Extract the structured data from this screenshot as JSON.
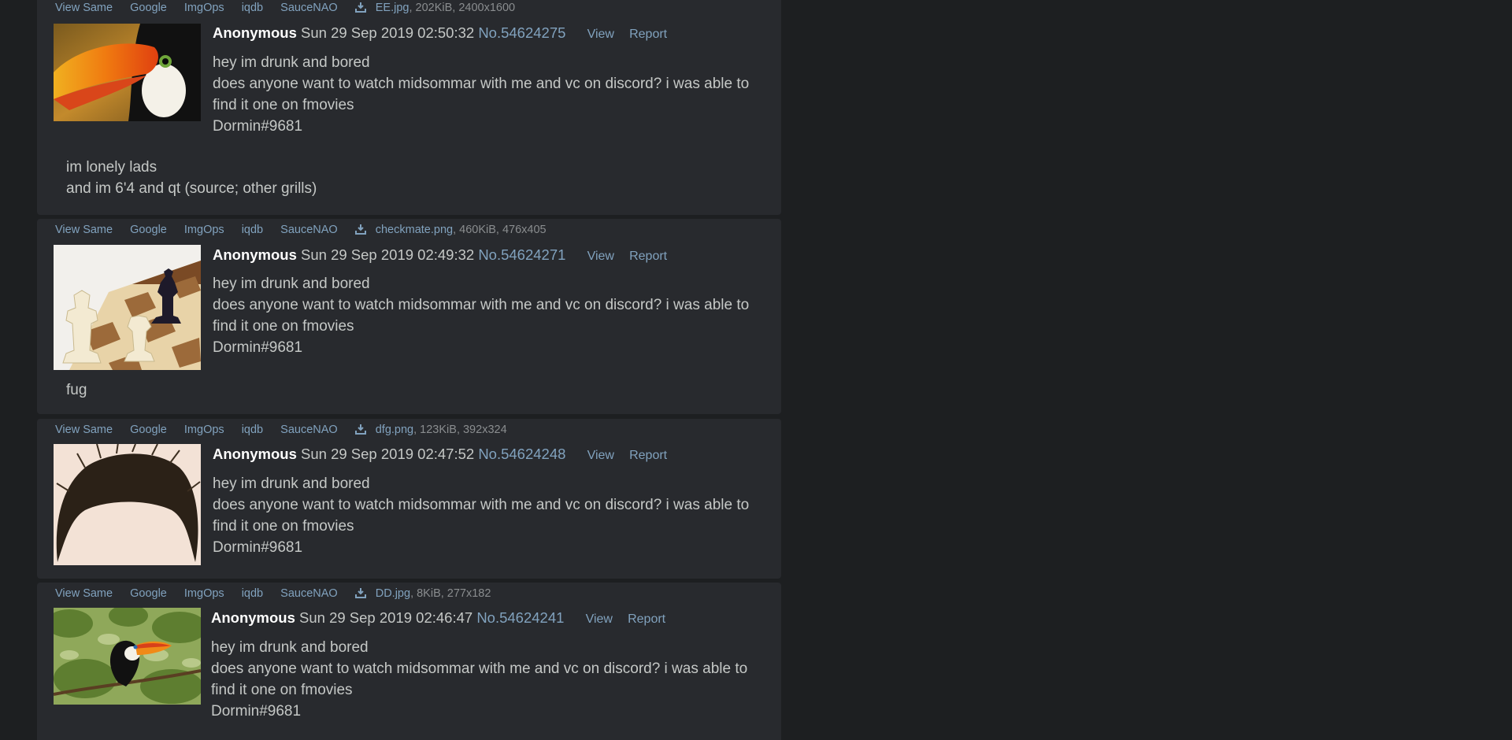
{
  "toolbar_labels": {
    "view_same": "View Same",
    "google": "Google",
    "imgops": "ImgOps",
    "iqdb": "iqdb",
    "saucenao": "SauceNAO",
    "download_icon": "download-icon"
  },
  "post_actions": {
    "view": "View",
    "report": "Report"
  },
  "posts": [
    {
      "file_name": "EE.jpg",
      "file_meta": ", 202KiB, 2400x1600",
      "thumbnail": "toucan-closeup",
      "name": "Anonymous",
      "date": "Sun 29 Sep 2019 02:50:32",
      "post_no": "No.54624275",
      "lines": [
        "hey im drunk and bored",
        "does anyone want to watch midsommar with me and vc on discord? i was able to find it one on fmovies",
        "Dormin#9681"
      ],
      "extra_lines": [
        "im lonely lads",
        "and im 6'4 and qt (source; other grills)"
      ]
    },
    {
      "file_name": "checkmate.png",
      "file_meta": ", 460KiB, 476x405",
      "thumbnail": "chess-pieces",
      "name": "Anonymous",
      "date": "Sun 29 Sep 2019 02:49:32",
      "post_no": "No.54624271",
      "lines": [
        "hey im drunk and bored",
        "does anyone want to watch midsommar with me and vc on discord? i was able to find it one on fmovies",
        "Dormin#9681"
      ],
      "extra_lines": [
        "fug"
      ]
    },
    {
      "file_name": "dfg.png",
      "file_meta": ", 123KiB, 392x324",
      "thumbnail": "hair-cutout",
      "name": "Anonymous",
      "date": "Sun 29 Sep 2019 02:47:52",
      "post_no": "No.54624248",
      "lines": [
        "hey im drunk and bored",
        "does anyone want to watch midsommar with me and vc on discord? i was able to find it one on fmovies",
        "Dormin#9681"
      ],
      "extra_lines": []
    },
    {
      "file_name": "DD.jpg",
      "file_meta": ", 8KiB, 277x182",
      "thumbnail": "toucan-on-branch",
      "name": "Anonymous",
      "date": "Sun 29 Sep 2019 02:46:47",
      "post_no": "No.54624241",
      "lines": [
        "hey im drunk and bored",
        "does anyone want to watch midsommar with me and vc on discord? i was able to find it one on fmovies",
        "Dormin#9681"
      ],
      "extra_lines": []
    }
  ]
}
